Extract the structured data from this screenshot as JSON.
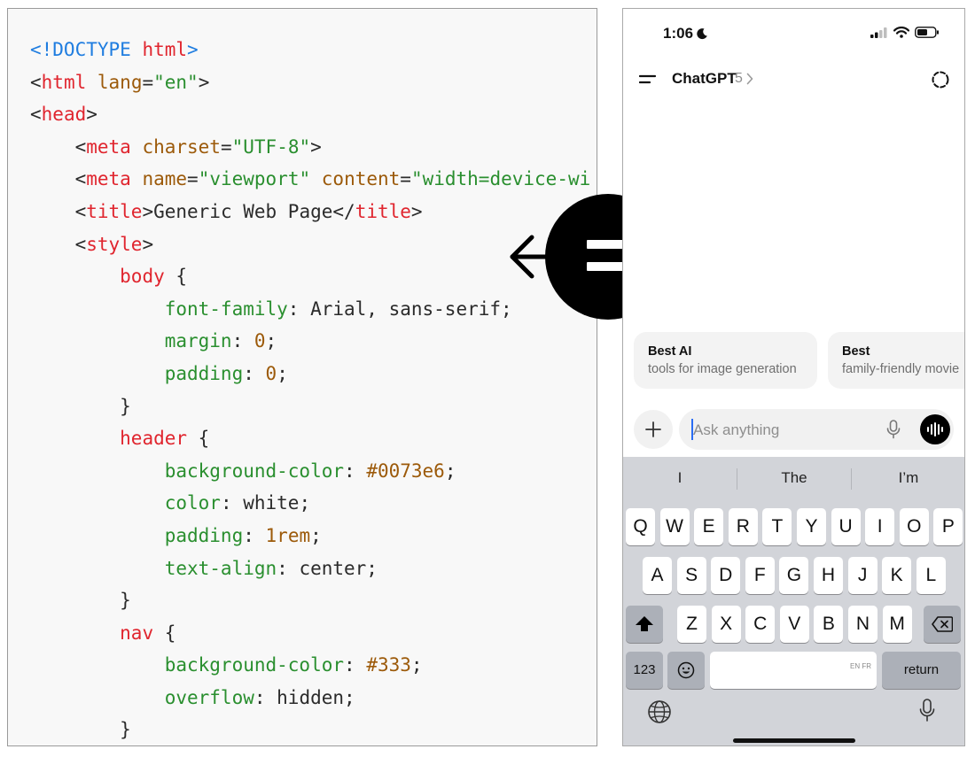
{
  "code": {
    "lines": [
      [
        [
          "t-doc",
          "<!DOCTYPE "
        ],
        [
          "t-tag",
          "html"
        ],
        [
          "t-doc",
          ">"
        ]
      ],
      [
        [
          "t-pun",
          "<"
        ],
        [
          "t-tag",
          "html"
        ],
        [
          "t-pun",
          " "
        ],
        [
          "t-attr",
          "lang"
        ],
        [
          "t-pun",
          "="
        ],
        [
          "t-str",
          "\"en\""
        ],
        [
          "t-pun",
          ">"
        ]
      ],
      [
        [
          "t-pun",
          "<"
        ],
        [
          "t-tag",
          "head"
        ],
        [
          "t-pun",
          ">"
        ]
      ],
      [
        [
          "t-pun",
          "    <"
        ],
        [
          "t-tag",
          "meta"
        ],
        [
          "t-pun",
          " "
        ],
        [
          "t-attr",
          "charset"
        ],
        [
          "t-pun",
          "="
        ],
        [
          "t-str",
          "\"UTF-8\""
        ],
        [
          "t-pun",
          ">"
        ]
      ],
      [
        [
          "t-pun",
          "    <"
        ],
        [
          "t-tag",
          "meta"
        ],
        [
          "t-pun",
          " "
        ],
        [
          "t-attr",
          "name"
        ],
        [
          "t-pun",
          "="
        ],
        [
          "t-str",
          "\"viewport\""
        ],
        [
          "t-pun",
          " "
        ],
        [
          "t-attr",
          "content"
        ],
        [
          "t-pun",
          "="
        ],
        [
          "t-str",
          "\"width=device-wi"
        ]
      ],
      [
        [
          "t-pun",
          "    <"
        ],
        [
          "t-tag",
          "title"
        ],
        [
          "t-pun",
          ">"
        ],
        [
          "t-txt",
          "Generic Web Page"
        ],
        [
          "t-pun",
          "</"
        ],
        [
          "t-tag",
          "title"
        ],
        [
          "t-pun",
          ">"
        ]
      ],
      [
        [
          "t-pun",
          "    <"
        ],
        [
          "t-tag",
          "style"
        ],
        [
          "t-pun",
          ">"
        ]
      ],
      [
        [
          "t-pun",
          "        "
        ],
        [
          "t-sel",
          "body"
        ],
        [
          "t-pun",
          " {"
        ]
      ],
      [
        [
          "t-pun",
          "            "
        ],
        [
          "t-prop",
          "font-family"
        ],
        [
          "t-pun",
          ": Arial, sans-serif;"
        ]
      ],
      [
        [
          "t-pun",
          "            "
        ],
        [
          "t-prop",
          "margin"
        ],
        [
          "t-pun",
          ": "
        ],
        [
          "t-num",
          "0"
        ],
        [
          "t-pun",
          ";"
        ]
      ],
      [
        [
          "t-pun",
          "            "
        ],
        [
          "t-prop",
          "padding"
        ],
        [
          "t-pun",
          ": "
        ],
        [
          "t-num",
          "0"
        ],
        [
          "t-pun",
          ";"
        ]
      ],
      [
        [
          "t-pun",
          "        }"
        ]
      ],
      [
        [
          "t-pun",
          "        "
        ],
        [
          "t-sel",
          "header"
        ],
        [
          "t-pun",
          " {"
        ]
      ],
      [
        [
          "t-pun",
          "            "
        ],
        [
          "t-prop",
          "background-color"
        ],
        [
          "t-pun",
          ": "
        ],
        [
          "t-num",
          "#0073e6"
        ],
        [
          "t-pun",
          ";"
        ]
      ],
      [
        [
          "t-pun",
          "            "
        ],
        [
          "t-prop",
          "color"
        ],
        [
          "t-pun",
          ": white;"
        ]
      ],
      [
        [
          "t-pun",
          "            "
        ],
        [
          "t-prop",
          "padding"
        ],
        [
          "t-pun",
          ": "
        ],
        [
          "t-num",
          "1rem"
        ],
        [
          "t-pun",
          ";"
        ]
      ],
      [
        [
          "t-pun",
          "            "
        ],
        [
          "t-prop",
          "text-align"
        ],
        [
          "t-pun",
          ": center;"
        ]
      ],
      [
        [
          "t-pun",
          "        }"
        ]
      ],
      [
        [
          "t-pun",
          "        "
        ],
        [
          "t-sel",
          "nav"
        ],
        [
          "t-pun",
          " {"
        ]
      ],
      [
        [
          "t-pun",
          "            "
        ],
        [
          "t-prop",
          "background-color"
        ],
        [
          "t-pun",
          ": "
        ],
        [
          "t-num",
          "#333"
        ],
        [
          "t-pun",
          ";"
        ]
      ],
      [
        [
          "t-pun",
          "            "
        ],
        [
          "t-prop",
          "overflow"
        ],
        [
          "t-pun",
          ": hidden;"
        ]
      ],
      [
        [
          "t-pun",
          "        }"
        ]
      ]
    ]
  },
  "badge": {
    "symbol": "=",
    "icon": "equals-icon",
    "arrows": "left-right-arrows-icon"
  },
  "phone": {
    "status": {
      "time": "1:06",
      "icons": [
        "moon-icon",
        "signal-icon",
        "wifi-icon",
        "battery-icon"
      ]
    },
    "header": {
      "title": "ChatGPT",
      "version": "5",
      "menu_icon": "menu-icon",
      "new_chat_icon": "dashed-circle-icon"
    },
    "suggestions": [
      {
        "title": "Best AI",
        "subtitle": "tools for image generation"
      },
      {
        "title": "Best",
        "subtitle": "family-friendly movie"
      }
    ],
    "input": {
      "placeholder": "Ask anything"
    },
    "keyboard": {
      "predictions": [
        "I",
        "The",
        "I’m"
      ],
      "row1": [
        "Q",
        "W",
        "E",
        "R",
        "T",
        "Y",
        "U",
        "I",
        "O",
        "P"
      ],
      "row2": [
        "A",
        "S",
        "D",
        "F",
        "G",
        "H",
        "J",
        "K",
        "L"
      ],
      "row3": [
        "Z",
        "X",
        "C",
        "V",
        "B",
        "N",
        "M"
      ],
      "numbers_label": "123",
      "return_label": "return",
      "space_lang": "EN FR"
    }
  }
}
